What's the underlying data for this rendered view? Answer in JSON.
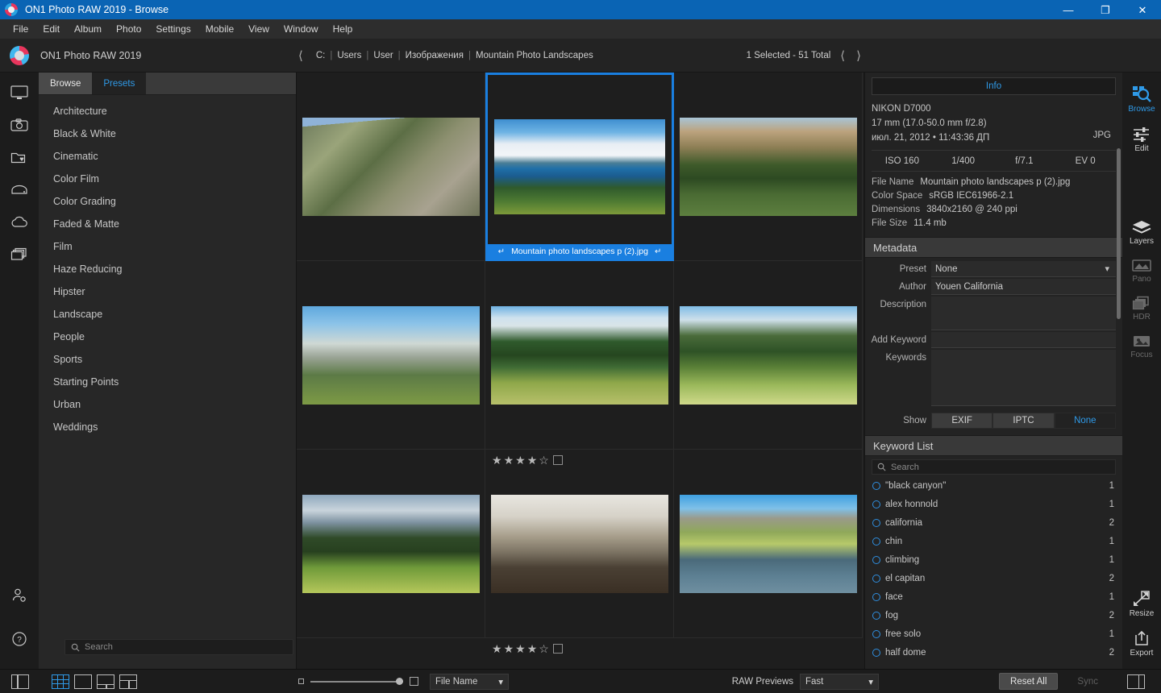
{
  "window": {
    "title": "ON1 Photo RAW 2019 - Browse",
    "logo_icon": "on1-logo-icon",
    "controls": [
      {
        "name": "minimize-button",
        "glyph": "—"
      },
      {
        "name": "restore-button",
        "glyph": "❐"
      },
      {
        "name": "close-button",
        "glyph": "✕"
      }
    ]
  },
  "menubar": {
    "items": [
      "File",
      "Edit",
      "Album",
      "Photo",
      "Settings",
      "Mobile",
      "View",
      "Window",
      "Help"
    ]
  },
  "appheader": {
    "app_name": "ON1 Photo RAW 2019",
    "back_icon": "chevron-left-icon",
    "breadcrumb": [
      "C:",
      "Users",
      "User",
      "Изображения",
      "Mountain Photo Landscapes"
    ],
    "selection_count": "1 Selected - 51 Total",
    "prev_icon": "chevron-left-icon",
    "next_icon": "chevron-right-icon"
  },
  "left_rail": {
    "icons": [
      "monitor-icon",
      "camera-icon",
      "folder-favorite-icon",
      "drive-icon",
      "cloud-icon",
      "catalog-stack-icon"
    ],
    "bottom_icons": [
      "user-settings-icon",
      "help-icon"
    ]
  },
  "left_panel": {
    "tabs": [
      {
        "label": "Browse",
        "active": true
      },
      {
        "label": "Presets",
        "active": false
      }
    ],
    "items": [
      "Architecture",
      "Black & White",
      "Cinematic",
      "Color Film",
      "Color Grading",
      "Faded & Matte",
      "Film",
      "Haze Reducing",
      "Hipster",
      "Landscape",
      "People",
      "Sports",
      "Starting Points",
      "Urban",
      "Weddings"
    ],
    "search": {
      "placeholder": "Search",
      "value": "",
      "icon": "search-icon"
    }
  },
  "grid": {
    "selected_label": "Mountain photo landscapes p (2).jpg",
    "label_left_icon": "arrow-down-left-icon",
    "label_right_icon": "arrow-down-right-icon",
    "cells": [
      {
        "row": 0,
        "col": 0,
        "name": "thumbnail-alpine-valley",
        "selected": false,
        "rating": null
      },
      {
        "row": 0,
        "col": 1,
        "name": "thumbnail-mountain-lake",
        "selected": true,
        "rating": null
      },
      {
        "row": 0,
        "col": 2,
        "name": "thumbnail-teton-reflection",
        "selected": false,
        "rating": null
      },
      {
        "row": 1,
        "col": 0,
        "name": "thumbnail-half-dome",
        "selected": false,
        "rating": null
      },
      {
        "row": 1,
        "col": 1,
        "name": "thumbnail-forest-pond",
        "selected": false,
        "rating": 4
      },
      {
        "row": 1,
        "col": 2,
        "name": "thumbnail-mountain-meadow-lake",
        "selected": false,
        "rating": null
      },
      {
        "row": 2,
        "col": 0,
        "name": "thumbnail-teton-meadow",
        "selected": false,
        "rating": null
      },
      {
        "row": 2,
        "col": 1,
        "name": "thumbnail-el-capitan",
        "selected": false,
        "rating": 4
      },
      {
        "row": 2,
        "col": 2,
        "name": "thumbnail-snake-river",
        "selected": false,
        "rating": null
      }
    ],
    "rating_filled_glyph": "★",
    "rating_empty_glyph": "☆",
    "rating_max": 5
  },
  "info_panel": {
    "tab_label": "Info",
    "camera": "NIKON D7000",
    "lens": "17 mm (17.0-50.0 mm f/2.8)",
    "datetime": "июл. 21, 2012 • 11:43:36 ДП",
    "format": "JPG",
    "exif": [
      "ISO 160",
      "1/400",
      "f/7.1",
      "EV 0"
    ],
    "fields": [
      {
        "key": "File Name",
        "value": "Mountain photo landscapes p (2).jpg"
      },
      {
        "key": "Color Space",
        "value": "sRGB IEC61966-2.1"
      },
      {
        "key": "Dimensions",
        "value": "3840x2160 @ 240 ppi"
      },
      {
        "key": "File Size",
        "value": "11.4 mb"
      }
    ]
  },
  "metadata_panel": {
    "title": "Metadata",
    "preset_label": "Preset",
    "preset_value": "None",
    "preset_caret_icon": "chevron-down-icon",
    "author_label": "Author",
    "author_value": "Youen California",
    "description_label": "Description",
    "description_value": "",
    "add_keyword_label": "Add Keyword",
    "add_keyword_value": "",
    "keywords_label": "Keywords",
    "keywords_value": "",
    "show_label": "Show",
    "show_options": [
      {
        "label": "EXIF",
        "active": false
      },
      {
        "label": "IPTC",
        "active": false
      },
      {
        "label": "None",
        "active": true
      }
    ]
  },
  "keyword_list": {
    "title": "Keyword List",
    "search": {
      "placeholder": "Search",
      "value": "",
      "icon": "search-icon"
    },
    "items": [
      {
        "label": "\"black canyon\"",
        "count": "1"
      },
      {
        "label": "alex honnold",
        "count": "1"
      },
      {
        "label": "california",
        "count": "2"
      },
      {
        "label": "chin",
        "count": "1"
      },
      {
        "label": "climbing",
        "count": "1"
      },
      {
        "label": "el capitan",
        "count": "2"
      },
      {
        "label": "face",
        "count": "1"
      },
      {
        "label": "fog",
        "count": "2"
      },
      {
        "label": "free solo",
        "count": "1"
      },
      {
        "label": "half dome",
        "count": "2"
      }
    ]
  },
  "right_rail": {
    "modules": [
      {
        "label": "Browse",
        "icon": "browse-magnifier-icon",
        "state": "active"
      },
      {
        "label": "Edit",
        "icon": "sliders-icon",
        "state": "normal"
      },
      {
        "label": "Layers",
        "icon": "layers-icon",
        "state": "normal"
      },
      {
        "label": "Pano",
        "icon": "panorama-icon",
        "state": "disabled"
      },
      {
        "label": "HDR",
        "icon": "hdr-stack-icon",
        "state": "disabled"
      },
      {
        "label": "Focus",
        "icon": "focus-image-icon",
        "state": "disabled"
      },
      {
        "label": "Resize",
        "icon": "resize-arrow-icon",
        "state": "normal"
      },
      {
        "label": "Export",
        "icon": "export-upload-icon",
        "state": "normal"
      }
    ]
  },
  "bottom_bar": {
    "panel_toggle_icon": "left-panel-toggle-icon",
    "view_modes": [
      {
        "name": "grid-view-icon",
        "active": true
      },
      {
        "name": "single-view-icon",
        "active": false
      },
      {
        "name": "filmstrip-bottom-view-icon",
        "active": false
      },
      {
        "name": "compare-view-icon",
        "active": false
      }
    ],
    "zoom_small_icon": "small-thumbnail-icon",
    "zoom_large_icon": "large-thumbnail-icon",
    "zoom_value": 100,
    "sort_label": "File Name",
    "sort_caret_icon": "chevron-down-icon",
    "raw_previews_label": "RAW Previews",
    "raw_previews_value": "Fast",
    "raw_caret_icon": "chevron-down-icon",
    "reset_all_label": "Reset All",
    "sync_label": "Sync",
    "right_panel_toggle_icon": "right-panel-toggle-icon"
  },
  "colors": {
    "accent_blue": "#2f9ae8",
    "selection_blue": "#1a7fe0",
    "titlebar_blue": "#0a64b4",
    "panel_bg": "#232323",
    "app_bg": "#1e1e1e"
  }
}
